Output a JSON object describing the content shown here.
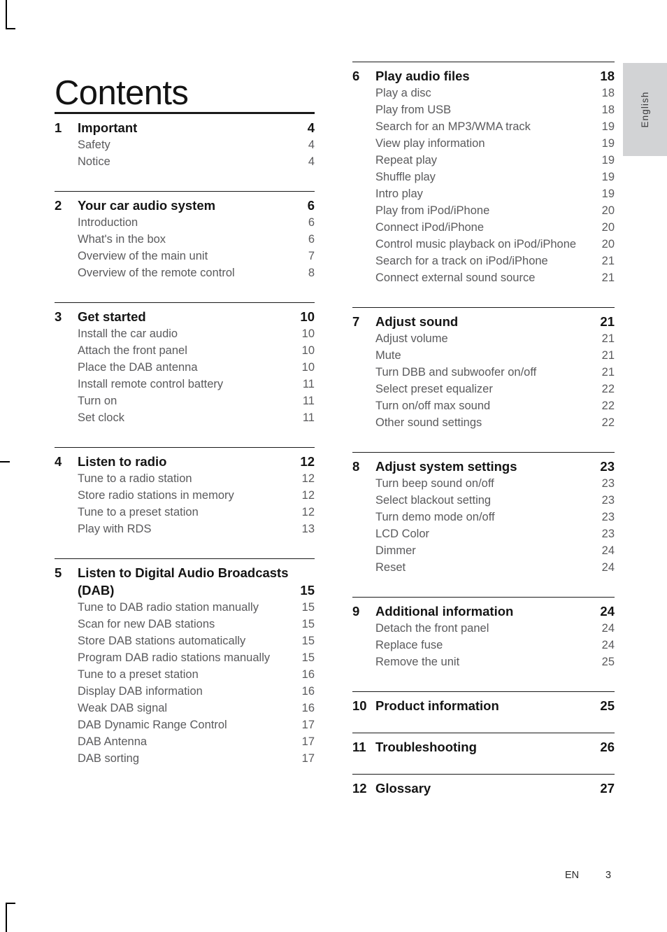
{
  "page_title": "Contents",
  "side_tab": {
    "language_label": "English"
  },
  "footer": {
    "locale_code": "EN",
    "page_number": "3"
  },
  "columns": {
    "left": [
      {
        "number": "1",
        "title": "Important",
        "page": "4",
        "rule": "thick",
        "items": [
          {
            "label": "Safety",
            "page": "4"
          },
          {
            "label": "Notice",
            "page": "4"
          }
        ]
      },
      {
        "number": "2",
        "title": "Your car audio system",
        "page": "6",
        "rule": "thin",
        "items": [
          {
            "label": "Introduction",
            "page": "6"
          },
          {
            "label": "What's in the box",
            "page": "6"
          },
          {
            "label": "Overview of the main unit",
            "page": "7"
          },
          {
            "label": "Overview of the remote control",
            "page": "8"
          }
        ]
      },
      {
        "number": "3",
        "title": "Get started",
        "page": "10",
        "rule": "thin",
        "items": [
          {
            "label": "Install the car audio",
            "page": "10"
          },
          {
            "label": "Attach the front panel",
            "page": "10"
          },
          {
            "label": "Place the DAB antenna",
            "page": "10"
          },
          {
            "label": "Install remote control battery",
            "page": "11"
          },
          {
            "label": "Turn on",
            "page": "11"
          },
          {
            "label": "Set clock",
            "page": "11"
          }
        ]
      },
      {
        "number": "4",
        "title": "Listen to radio",
        "page": "12",
        "rule": "thin",
        "items": [
          {
            "label": "Tune to a radio station",
            "page": "12"
          },
          {
            "label": "Store radio stations in memory",
            "page": "12"
          },
          {
            "label": "Tune to a preset station",
            "page": "12"
          },
          {
            "label": "Play with RDS",
            "page": "13"
          }
        ]
      },
      {
        "number": "5",
        "title": "Listen to Digital Audio Broadcasts (DAB)",
        "page": "15",
        "rule": "thin",
        "items": [
          {
            "label": "Tune to DAB radio station manually",
            "page": "15"
          },
          {
            "label": "Scan for new DAB stations",
            "page": "15"
          },
          {
            "label": "Store DAB stations automatically",
            "page": "15"
          },
          {
            "label": "Program DAB radio stations manually",
            "page": "15"
          },
          {
            "label": "Tune to a preset station",
            "page": "16"
          },
          {
            "label": "Display DAB information",
            "page": "16"
          },
          {
            "label": "Weak DAB signal",
            "page": "16"
          },
          {
            "label": "DAB Dynamic Range Control",
            "page": "17"
          },
          {
            "label": "DAB Antenna",
            "page": "17"
          },
          {
            "label": "DAB sorting",
            "page": "17"
          }
        ]
      }
    ],
    "right": [
      {
        "number": "6",
        "title": "Play audio files",
        "page": "18",
        "rule": "thin",
        "items": [
          {
            "label": "Play a disc",
            "page": "18"
          },
          {
            "label": "Play from USB",
            "page": "18"
          },
          {
            "label": "Search for an MP3/WMA track",
            "page": "19"
          },
          {
            "label": "View play information",
            "page": "19"
          },
          {
            "label": "Repeat play",
            "page": "19"
          },
          {
            "label": "Shuffle play",
            "page": "19"
          },
          {
            "label": "Intro play",
            "page": "19"
          },
          {
            "label": "Play from iPod/iPhone",
            "page": "20"
          },
          {
            "label": "Connect iPod/iPhone",
            "page": "20"
          },
          {
            "label": "Control music playback on iPod/iPhone",
            "page": "20"
          },
          {
            "label": "Search for a track on iPod/iPhone",
            "page": "21"
          },
          {
            "label": "Connect external sound source",
            "page": "21"
          }
        ]
      },
      {
        "number": "7",
        "title": "Adjust sound",
        "page": "21",
        "rule": "thin",
        "items": [
          {
            "label": "Adjust volume",
            "page": "21"
          },
          {
            "label": "Mute",
            "page": "21"
          },
          {
            "label": "Turn DBB and subwoofer on/off",
            "page": "21"
          },
          {
            "label": "Select preset equalizer",
            "page": "22"
          },
          {
            "label": "Turn on/off max sound",
            "page": "22"
          },
          {
            "label": "Other sound settings",
            "page": "22"
          }
        ]
      },
      {
        "number": "8",
        "title": "Adjust system settings",
        "page": "23",
        "rule": "thin",
        "items": [
          {
            "label": "Turn beep sound on/off",
            "page": "23"
          },
          {
            "label": "Select blackout setting",
            "page": "23"
          },
          {
            "label": "Turn demo mode on/off",
            "page": "23"
          },
          {
            "label": "LCD Color",
            "page": "23"
          },
          {
            "label": "Dimmer",
            "page": "24"
          },
          {
            "label": "Reset",
            "page": "24"
          }
        ]
      },
      {
        "number": "9",
        "title": "Additional information",
        "page": "24",
        "rule": "thin",
        "items": [
          {
            "label": "Detach the front panel",
            "page": "24"
          },
          {
            "label": "Replace fuse",
            "page": "24"
          },
          {
            "label": "Remove the unit",
            "page": "25"
          }
        ]
      },
      {
        "number": "10",
        "title": "Product information",
        "page": "25",
        "rule": "thin",
        "items": []
      },
      {
        "number": "11",
        "title": "Troubleshooting",
        "page": "26",
        "rule": "thin",
        "items": []
      },
      {
        "number": "12",
        "title": "Glossary",
        "page": "27",
        "rule": "thin",
        "items": []
      }
    ]
  }
}
